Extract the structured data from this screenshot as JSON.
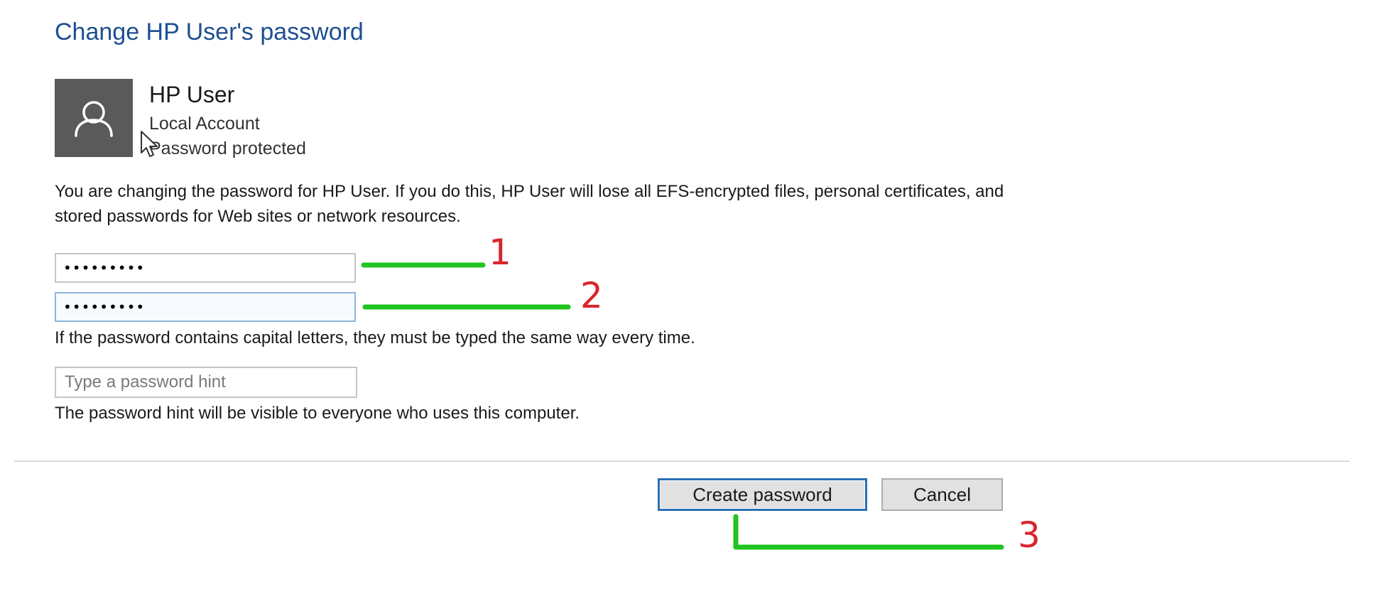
{
  "page": {
    "title": "Change HP User's password"
  },
  "account": {
    "name": "HP User",
    "type": "Local Account",
    "status": "Password protected"
  },
  "warning_text": "You are changing the password for HP User.  If you do this, HP User will lose all EFS-encrypted files, personal certificates, and stored passwords for Web sites or network resources.",
  "fields": {
    "new_password_value": "•••••••••",
    "confirm_password_value": "•••••••••",
    "caps_note": "If the password contains capital letters, they must be typed the same way every time.",
    "hint_placeholder": "Type a password hint",
    "hint_value": "",
    "hint_note": "The password hint will be visible to everyone who uses this computer."
  },
  "buttons": {
    "create_label": "Create password",
    "cancel_label": "Cancel"
  },
  "annotations": {
    "marker_1": "1",
    "marker_2": "2",
    "marker_3": "3"
  },
  "icons": {
    "avatar": "user-icon",
    "cursor": "mouse-pointer-icon"
  },
  "colors": {
    "title": "#1e4f91",
    "avatar_bg": "#5a5a5a",
    "focus_border": "#2a6fb5",
    "annotation_line": "#1fc41f",
    "annotation_number": "#d9262b"
  }
}
